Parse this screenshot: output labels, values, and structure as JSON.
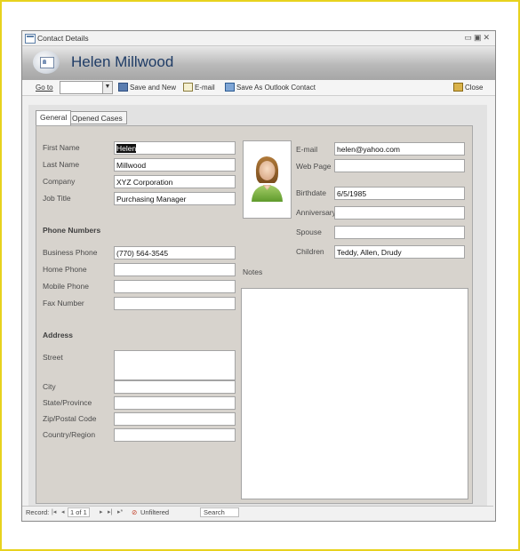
{
  "window": {
    "title": "Contact Details"
  },
  "header": {
    "contact_name": "Helen Millwood"
  },
  "toolbar": {
    "goto_label": "Go to",
    "save_new_label": "Save and New",
    "email_label": "E-mail",
    "save_outlook_label": "Save As Outlook Contact",
    "close_label": "Close"
  },
  "tabs": [
    {
      "label": "General"
    },
    {
      "label": "Opened Cases"
    }
  ],
  "fields": {
    "first_name": {
      "label": "First Name",
      "value": "Helen"
    },
    "last_name": {
      "label": "Last Name",
      "value": "Millwood"
    },
    "company": {
      "label": "Company",
      "value": "XYZ Corporation"
    },
    "job_title": {
      "label": "Job Title",
      "value": "Purchasing Manager"
    },
    "email": {
      "label": "E-mail",
      "value": "helen@yahoo.com"
    },
    "web_page": {
      "label": "Web Page",
      "value": ""
    },
    "birthdate": {
      "label": "Birthdate",
      "value": "6/5/1985"
    },
    "anniversary": {
      "label": "Anniversary",
      "value": ""
    },
    "spouse": {
      "label": "Spouse",
      "value": ""
    },
    "children": {
      "label": "Children",
      "value": "Teddy, Allen, Drudy"
    }
  },
  "phone": {
    "section_title": "Phone Numbers",
    "business": {
      "label": "Business Phone",
      "value": "(770) 564-3545"
    },
    "home": {
      "label": "Home Phone",
      "value": ""
    },
    "mobile": {
      "label": "Mobile Phone",
      "value": ""
    },
    "fax": {
      "label": "Fax Number",
      "value": ""
    }
  },
  "address": {
    "section_title": "Address",
    "street": {
      "label": "Street",
      "value": ""
    },
    "city": {
      "label": "City",
      "value": ""
    },
    "state": {
      "label": "State/Province",
      "value": ""
    },
    "zip": {
      "label": "Zip/Postal Code",
      "value": ""
    },
    "country": {
      "label": "Country/Region",
      "value": ""
    }
  },
  "notes": {
    "label": "Notes",
    "value": ""
  },
  "statusbar": {
    "record_label": "Record:",
    "record_position": "1 of 1",
    "filter_label": "Unfiltered",
    "search_label": "Search"
  },
  "colors": {
    "title_text": "#1f3c66",
    "panel_bg": "#d7d3cd",
    "header_gradient_dark": "#a6a6a6"
  }
}
